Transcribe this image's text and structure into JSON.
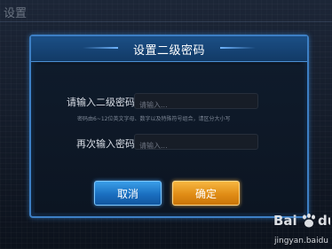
{
  "background": {
    "title": "设置"
  },
  "dialog": {
    "title": "设置二级密码",
    "password": {
      "label": "请输入二级密码",
      "placeholder": "请输入...",
      "hint": "密码由6~12位英文字母、数字以及特殊符号组合，请区分大小写"
    },
    "confirm": {
      "label": "再次输入密码",
      "placeholder": "请输入..."
    },
    "cancel_label": "取消",
    "ok_label": "确定"
  },
  "watermark": {
    "logo_text": "Bai du",
    "url": "jingyan.baidu"
  },
  "colors": {
    "accent_blue": "#3d7fc4",
    "cancel_button": "#1a6fc0",
    "ok_button": "#e08d16"
  }
}
